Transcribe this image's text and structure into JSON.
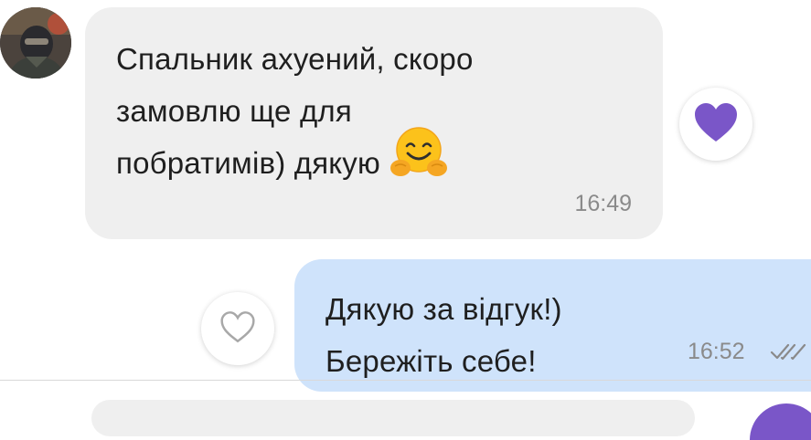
{
  "incoming_message": {
    "lines": [
      "Спальник ахуений, скоро",
      "замовлю ще для",
      "побратимів) дякую"
    ],
    "emoji": "hugging-face",
    "time": "16:49",
    "reaction": "heart-filled"
  },
  "outgoing_message": {
    "lines": [
      "Дякую за відгук!)",
      "Бережіть себе!"
    ],
    "time": "16:52",
    "status": "double-check-read",
    "reaction": "heart-outline"
  },
  "colors": {
    "incoming_bubble": "#efefef",
    "outgoing_bubble": "#cfe3fb",
    "heart_accent": "#7a56c8",
    "timestamp": "#8a8a8a"
  }
}
